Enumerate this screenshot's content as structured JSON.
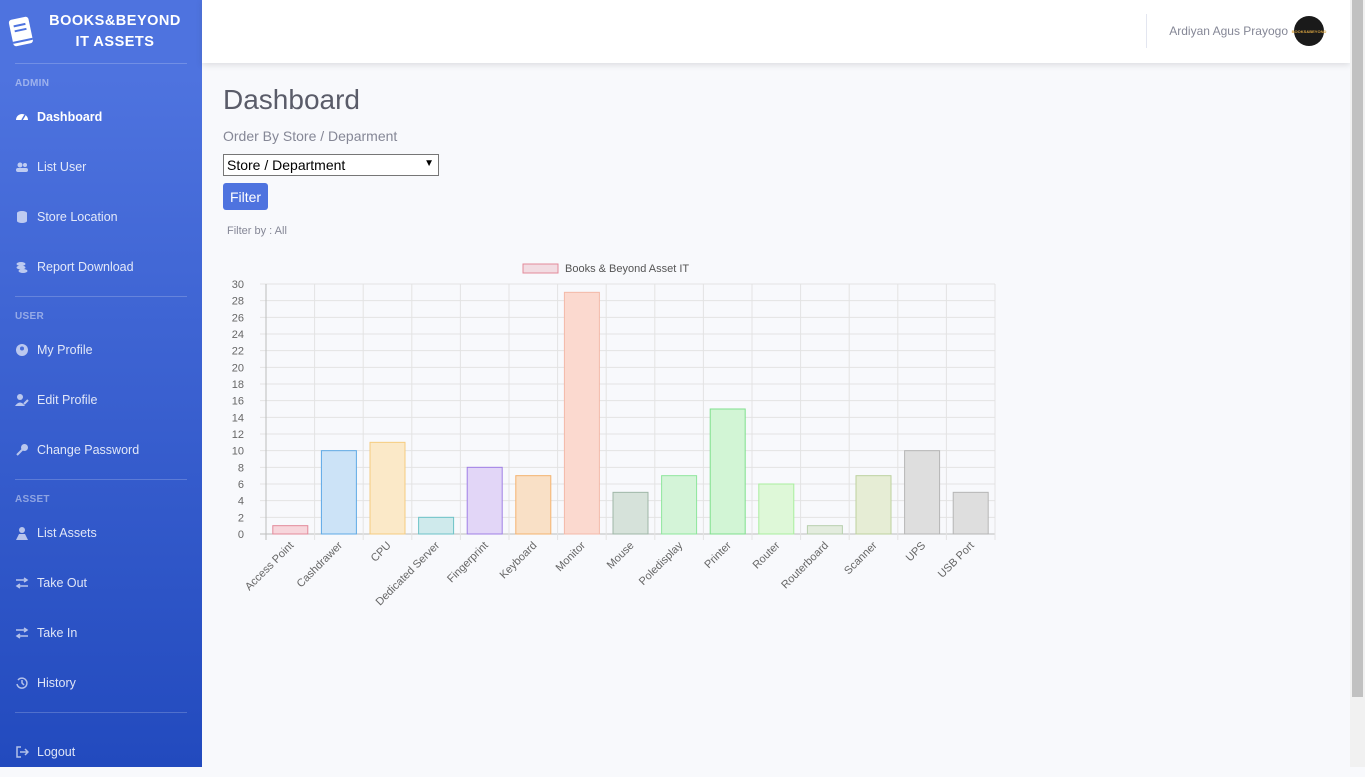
{
  "brand": {
    "line1": "BOOKS&BEYOND",
    "line2": "IT ASSETS"
  },
  "sidebar": {
    "sections": [
      {
        "heading": "ADMIN",
        "items": [
          {
            "label": "Dashboard",
            "icon": "tachometer-icon",
            "active": true
          },
          {
            "label": "List User",
            "icon": "users-icon"
          },
          {
            "label": "Store Location",
            "icon": "database-icon"
          },
          {
            "label": "Report Download",
            "icon": "coins-icon"
          }
        ]
      },
      {
        "heading": "USER",
        "items": [
          {
            "label": "My Profile",
            "icon": "user-circle-icon"
          },
          {
            "label": "Edit Profile",
            "icon": "user-edit-icon"
          },
          {
            "label": "Change Password",
            "icon": "key-icon"
          }
        ]
      },
      {
        "heading": "ASSET",
        "items": [
          {
            "label": "List Assets",
            "icon": "user-tie-icon"
          },
          {
            "label": "Take Out",
            "icon": "exchange-icon"
          },
          {
            "label": "Take In",
            "icon": "exchange-icon"
          },
          {
            "label": "History",
            "icon": "history-icon"
          }
        ]
      }
    ],
    "logout": {
      "label": "Logout",
      "icon": "sign-out-icon"
    }
  },
  "topbar": {
    "username": "Ardiyan Agus Prayogo",
    "avatar_text": "BOOKS&BEYOND"
  },
  "page": {
    "title": "Dashboard",
    "subtitle": "Order By Store / Deparment",
    "select_value": "Store / Department",
    "filter_button": "Filter",
    "filter_by": "Filter by : All"
  },
  "chart_data": {
    "type": "bar",
    "categories": [
      "Access Point",
      "Cashdrawer",
      "CPU",
      "Dedicated Server",
      "Fingerprint",
      "Keyboard",
      "Monitor",
      "Mouse",
      "Poledisplay",
      "Printer",
      "Router",
      "Routerboard",
      "Scanner",
      "UPS",
      "USB Port"
    ],
    "series": [
      {
        "name": "Books & Beyond Asset IT",
        "values": [
          1,
          10,
          11,
          2,
          8,
          7,
          29,
          5,
          7,
          15,
          6,
          1,
          7,
          10,
          5
        ]
      }
    ],
    "ylim": [
      0,
      30
    ],
    "yticks": [
      0,
      2,
      4,
      6,
      8,
      10,
      12,
      14,
      16,
      18,
      20,
      22,
      24,
      26,
      28,
      30
    ],
    "grid": true,
    "legend": "top",
    "colors": {
      "fills": [
        "#f7d6dc",
        "#cce3f7",
        "#fbe9c8",
        "#cfeaec",
        "#e2d6f7",
        "#f9e0c6",
        "#fbd9cf",
        "#d6e2da",
        "#d4f4d8",
        "#d2f5d5",
        "#def8d8",
        "#e3ecde",
        "#e6edd5",
        "#dedede",
        "#dedede"
      ],
      "borders": [
        "#e38a9a",
        "#5ea9e6",
        "#f5cc7f",
        "#6cc2c7",
        "#9f7fe6",
        "#f4b26e",
        "#f3b9a8",
        "#9fb7a7",
        "#8ee69c",
        "#7fe08d",
        "#a9ee9e",
        "#b8cfae",
        "#bdd19e",
        "#b5b5b5",
        "#b5b5b5"
      ],
      "legend_fill": "#f2dce2",
      "legend_border": "#e38a9a"
    }
  }
}
